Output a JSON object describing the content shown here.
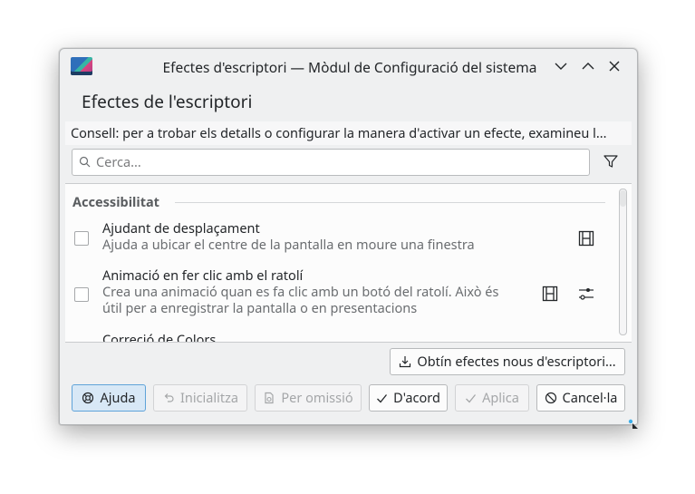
{
  "window": {
    "title": "Efectes d'escriptori — Mòdul de Configuració del sistema",
    "heading": "Efectes de l'escriptori"
  },
  "tip": "Consell: per a trobar els detalls o configurar la manera d'activar un efecte, examineu l...",
  "search": {
    "placeholder": "Cerca...",
    "value": ""
  },
  "list": {
    "section": "Accessibilitat",
    "items": [
      {
        "title": "Ajudant de desplaçament",
        "desc": "Ajuda a ubicar el centre de la pantalla en moure una finestra",
        "checked": false,
        "icons": [
          "video-preview-icon"
        ]
      },
      {
        "title": "Animació en fer clic amb el ratolí",
        "desc1": "Crea una animació quan es fa clic amb un botó del ratolí. Això és",
        "desc2": "útil per a enregistrar la pantalla o en presentacions",
        "checked": false,
        "icons": [
          "video-preview-icon",
          "configure-icon"
        ]
      },
      {
        "title": "Correció de Colors",
        "checked": false
      }
    ]
  },
  "buttons": {
    "get_new": "Obtín efectes nous d'escriptori...",
    "help": "Ajuda",
    "reset": "Inicialitza",
    "defaults": "Per omissió",
    "ok": "D'acord",
    "apply": "Aplica",
    "cancel": "Cancel·la"
  },
  "colors": {
    "accent": "#3daee9",
    "window_bg": "#eff0f1"
  }
}
